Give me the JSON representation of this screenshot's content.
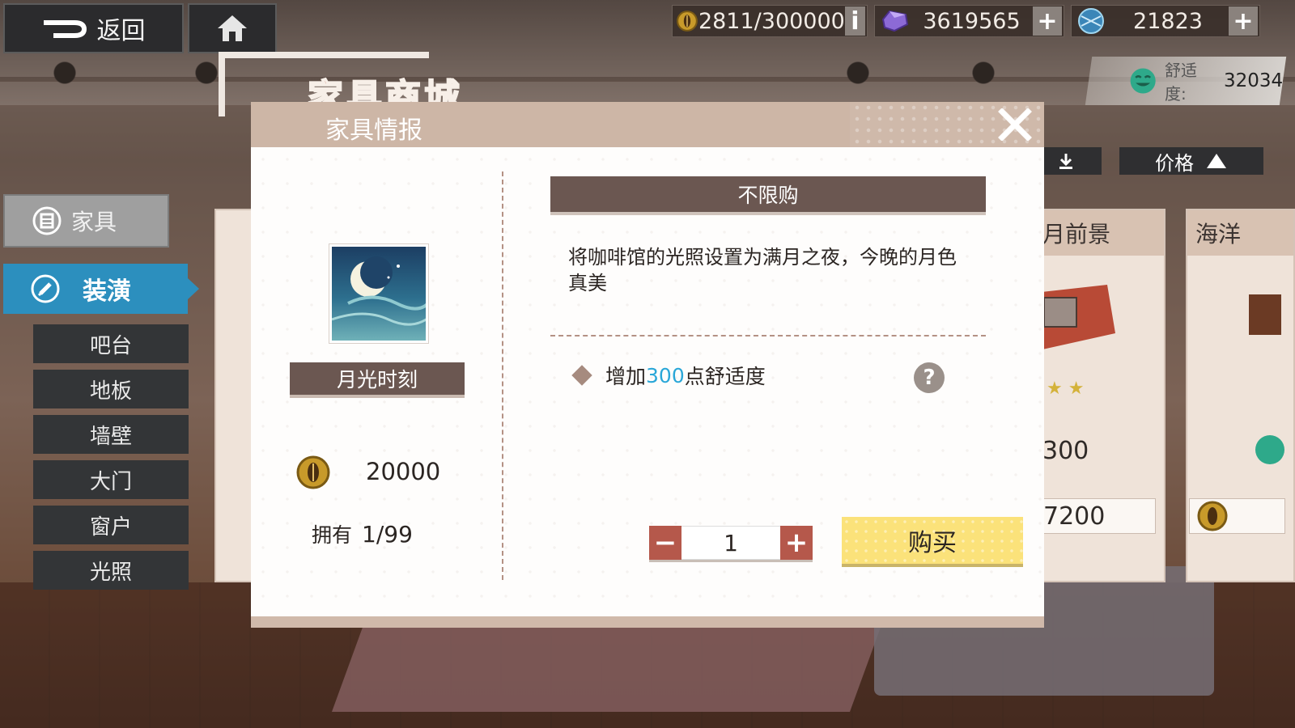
{
  "topbar": {
    "back_label": "返回",
    "resources": [
      {
        "icon": "coin-icon",
        "value": "2811/300000",
        "side": "i"
      },
      {
        "icon": "gem-icon",
        "value": "3619565",
        "side": "+"
      },
      {
        "icon": "orb-icon",
        "value": "21823",
        "side": "+"
      }
    ],
    "comfort_label": "舒适度:",
    "comfort_value": "32034"
  },
  "shop_title": "家具商城",
  "sidebar": {
    "main_category": "家具",
    "active_category": "装潢",
    "items": [
      {
        "label": "吧台"
      },
      {
        "label": "地板"
      },
      {
        "label": "墙壁"
      },
      {
        "label": "大门"
      },
      {
        "label": "窗户"
      },
      {
        "label": "光照"
      }
    ]
  },
  "sort": {
    "price_label": "价格"
  },
  "cards": [
    {
      "title": "月前景",
      "comfort": "300",
      "price": "7200",
      "stars": "★ ★"
    },
    {
      "title": "海洋"
    }
  ],
  "modal": {
    "title": "家具情报",
    "item_name": "月光时刻",
    "price": "20000",
    "owned_label": "拥有",
    "owned_count": "1/99",
    "limit_text": "不限购",
    "description": "将咖啡馆的光照设置为满月之夜，今晚的月色真美",
    "effect_prefix": "增加",
    "effect_value": "300",
    "effect_suffix": "点舒适度",
    "quantity": "1",
    "buy_label": "购买"
  },
  "colors": {
    "accent_blue": "#2c8fbe",
    "buy_yellow": "#fbe27a",
    "stepper_red": "#b5584b",
    "header_brown": "#6b5751",
    "highlight": "#2aa7d8"
  }
}
